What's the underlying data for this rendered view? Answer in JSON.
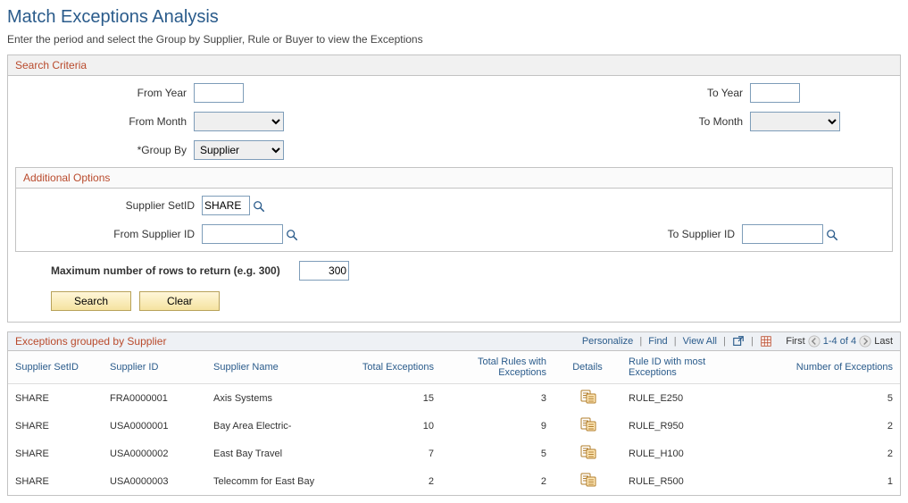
{
  "page": {
    "title": "Match Exceptions Analysis",
    "subtitle": "Enter the period and select the Group by Supplier, Rule or Buyer to view the Exceptions"
  },
  "search": {
    "group_title": "Search Criteria",
    "labels": {
      "from_year": "From Year",
      "to_year": "To Year",
      "from_month": "From Month",
      "to_month": "To Month",
      "group_by": "*Group By",
      "supplier_setid": "Supplier SetID",
      "from_supplier_id": "From Supplier ID",
      "to_supplier_id": "To Supplier ID",
      "max_rows": "Maximum number of rows to return (e.g. 300)"
    },
    "values": {
      "from_year": "",
      "to_year": "",
      "from_month": "",
      "to_month": "",
      "group_by": "Supplier",
      "supplier_setid": "SHARE",
      "from_supplier_id": "",
      "to_supplier_id": "",
      "max_rows": "300"
    },
    "additional_options_title": "Additional Options",
    "buttons": {
      "search": "Search",
      "clear": "Clear"
    }
  },
  "results": {
    "title": "Exceptions grouped by Supplier",
    "toolbar": {
      "personalize": "Personalize",
      "find": "Find",
      "view_all": "View All",
      "first": "First",
      "range": "1-4 of 4",
      "last": "Last"
    },
    "columns": {
      "supplier_setid": "Supplier SetID",
      "supplier_id": "Supplier ID",
      "supplier_name": "Supplier Name",
      "total_exceptions": "Total Exceptions",
      "total_rules": "Total Rules with Exceptions",
      "details": "Details",
      "rule_id_most": "Rule ID with most Exceptions",
      "num_exceptions": "Number of Exceptions"
    },
    "rows": [
      {
        "setid": "SHARE",
        "supplier_id": "FRA0000001",
        "supplier_name": "Axis Systems",
        "total_ex": 15,
        "total_rules": 3,
        "rule_id": "RULE_E250",
        "num_ex": 5
      },
      {
        "setid": "SHARE",
        "supplier_id": "USA0000001",
        "supplier_name": "Bay Area Electric-",
        "total_ex": 10,
        "total_rules": 9,
        "rule_id": "RULE_R950",
        "num_ex": 2
      },
      {
        "setid": "SHARE",
        "supplier_id": "USA0000002",
        "supplier_name": "East Bay Travel",
        "total_ex": 7,
        "total_rules": 5,
        "rule_id": "RULE_H100",
        "num_ex": 2
      },
      {
        "setid": "SHARE",
        "supplier_id": "USA0000003",
        "supplier_name": "Telecomm for East Bay",
        "total_ex": 2,
        "total_rules": 2,
        "rule_id": "RULE_R500",
        "num_ex": 1
      }
    ]
  }
}
